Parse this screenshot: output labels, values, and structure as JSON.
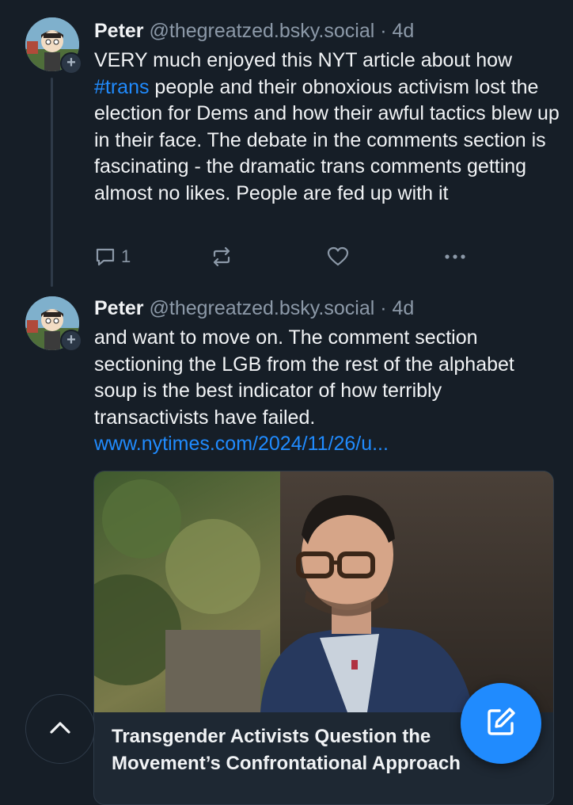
{
  "posts": [
    {
      "author_name": "Peter",
      "handle": "@thegreatzed.bsky.social",
      "separator": "·",
      "age": "4d",
      "text_before_tag": "VERY much enjoyed this NYT article about how ",
      "hashtag": "#trans",
      "text_after_tag": " people and their obnoxious activism lost the election for Dems and how their awful tactics blew up in their face. The debate in the comments section is fascinating - the dramatic trans comments getting almost no likes. People are fed up with it",
      "reply_count": "1"
    },
    {
      "author_name": "Peter",
      "handle": "@thegreatzed.bsky.social",
      "separator": "·",
      "age": "4d",
      "text": "and want to move on. The comment section sectioning the LGB from the rest of the alphabet soup is the best indicator of how terribly transactivists have failed. ",
      "link_text": "www.nytimes.com/2024/11/26/u...",
      "card_title": "Transgender Activists Question the Movement’s Confrontational Approach"
    }
  ],
  "icons": {
    "avatar_plus": "plus-icon",
    "reply": "speech-bubble-icon",
    "repost": "repost-icon",
    "like": "heart-icon",
    "more": "ellipsis-icon",
    "scroll_top": "chevron-up-icon",
    "compose": "compose-icon"
  },
  "colors": {
    "background": "#161e27",
    "accent": "#208bfe",
    "muted": "#8c99a8",
    "text": "#f1f3f5"
  }
}
